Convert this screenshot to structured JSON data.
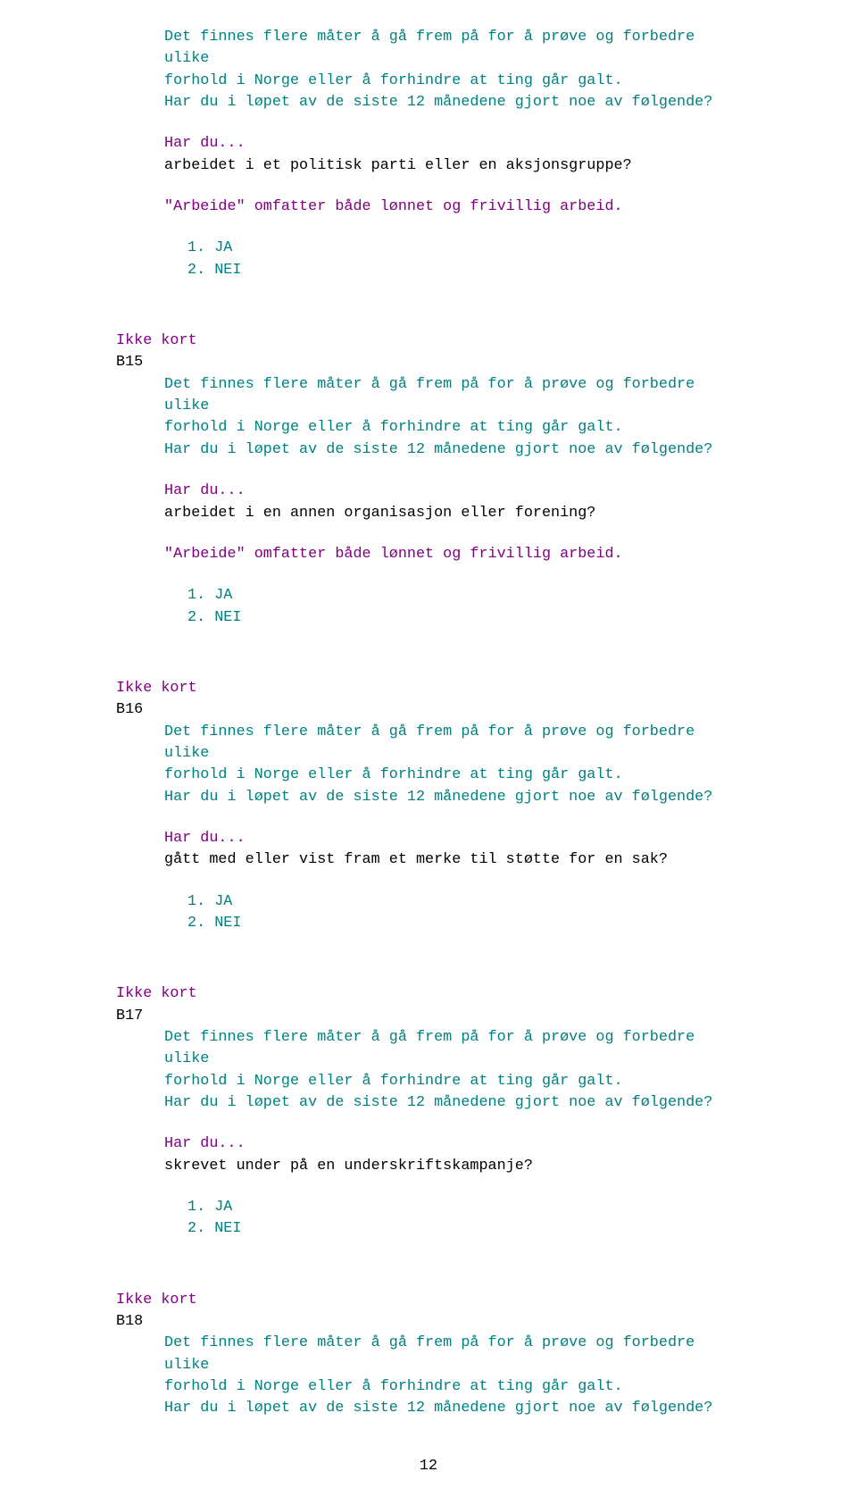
{
  "q14": {
    "intro_l1": "Det finnes flere måter å gå frem på for å prøve og forbedre ulike",
    "intro_l2": "forhold i Norge eller å forhindre at ting går galt.",
    "intro_l3": "Har du i løpet av de siste 12 månedene gjort noe av følgende?",
    "lead": "Har du...",
    "item": "arbeidet i et politisk parti eller en aksjonsgruppe?",
    "note": "\"Arbeide\" omfatter både lønnet og frivillig arbeid.",
    "opt1": "1. JA",
    "opt2": "2. NEI"
  },
  "q15": {
    "header": "Ikke kort",
    "code": "B15",
    "intro_l1": "Det finnes flere måter å gå frem på for å prøve og forbedre ulike",
    "intro_l2": "forhold i Norge eller å forhindre at ting går galt.",
    "intro_l3": "Har du i løpet av de siste 12 månedene gjort noe av følgende?",
    "lead": "Har du...",
    "item": "arbeidet i en annen organisasjon eller forening?",
    "note": "\"Arbeide\" omfatter både lønnet og frivillig arbeid.",
    "opt1": "1. JA",
    "opt2": "2. NEI"
  },
  "q16": {
    "header": "Ikke kort",
    "code": "B16",
    "intro_l1": "Det finnes flere måter å gå frem på for å prøve og forbedre ulike",
    "intro_l2": "forhold i Norge eller å forhindre at ting går galt.",
    "intro_l3": "Har du i løpet av de siste 12 månedene gjort noe av følgende?",
    "lead": "Har du...",
    "item": "gått med eller vist fram et merke til støtte for en sak?",
    "opt1": "1. JA",
    "opt2": "2. NEI"
  },
  "q17": {
    "header": "Ikke kort",
    "code": "B17",
    "intro_l1": "Det finnes flere måter å gå frem på for å prøve og forbedre ulike",
    "intro_l2": "forhold i Norge eller å forhindre at ting går galt.",
    "intro_l3": "Har du i løpet av de siste 12 månedene gjort noe av følgende?",
    "lead": "Har du...",
    "item": "skrevet under på en underskriftskampanje?",
    "opt1": "1. JA",
    "opt2": "2. NEI"
  },
  "q18": {
    "header": "Ikke kort",
    "code": "B18",
    "intro_l1": "Det finnes flere måter å gå frem på for å prøve og forbedre ulike",
    "intro_l2": "forhold i Norge eller å forhindre at ting går galt.",
    "intro_l3": "Har du i løpet av de siste 12 månedene gjort noe av følgende?"
  },
  "page_number": "12"
}
